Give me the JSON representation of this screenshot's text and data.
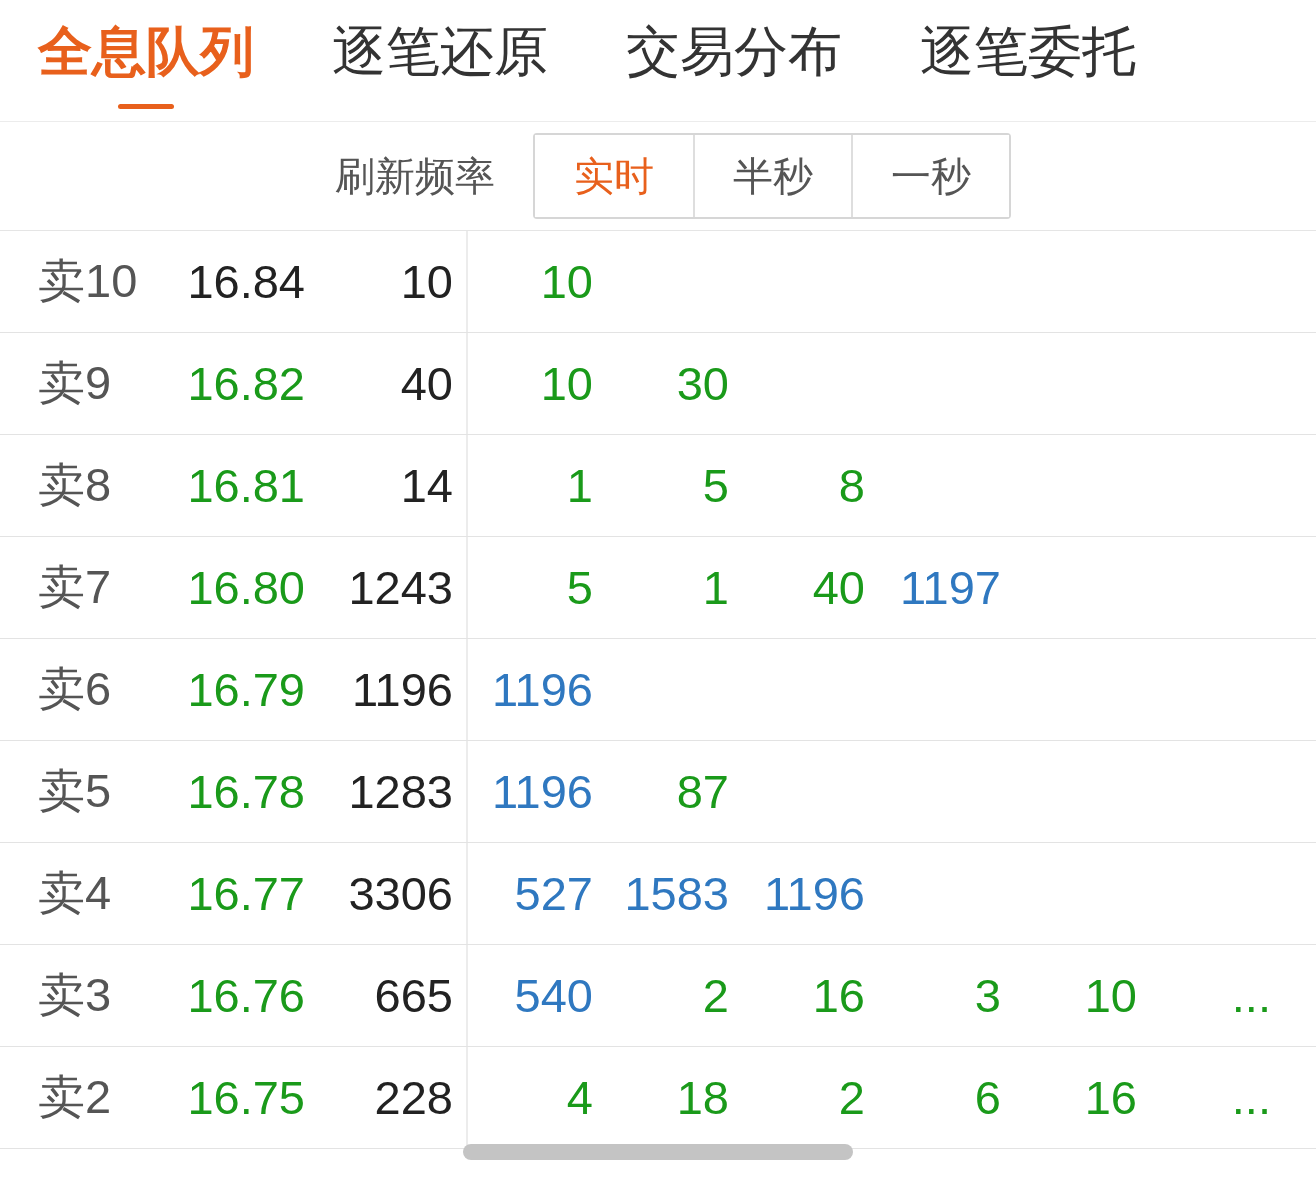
{
  "tabs": [
    {
      "label": "全息队列",
      "selected": true
    },
    {
      "label": "逐笔还原",
      "selected": false
    },
    {
      "label": "交易分布",
      "selected": false
    },
    {
      "label": "逐笔委托",
      "selected": false
    }
  ],
  "refresh": {
    "label": "刷新频率",
    "options": [
      {
        "label": "实时",
        "selected": true
      },
      {
        "label": "半秒",
        "selected": false
      },
      {
        "label": "一秒",
        "selected": false
      }
    ]
  },
  "rows": [
    {
      "label": "卖10",
      "price": {
        "text": "16.84",
        "color": "#222222"
      },
      "volume": "10",
      "queue": [
        {
          "text": "10",
          "color": "#1a9a1a"
        }
      ]
    },
    {
      "label": "卖9",
      "price": {
        "text": "16.82",
        "color": "#1a9a1a"
      },
      "volume": "40",
      "queue": [
        {
          "text": "10",
          "color": "#1a9a1a"
        },
        {
          "text": "30",
          "color": "#1a9a1a"
        }
      ]
    },
    {
      "label": "卖8",
      "price": {
        "text": "16.81",
        "color": "#1a9a1a"
      },
      "volume": "14",
      "queue": [
        {
          "text": "1",
          "color": "#1a9a1a"
        },
        {
          "text": "5",
          "color": "#1a9a1a"
        },
        {
          "text": "8",
          "color": "#1a9a1a"
        }
      ]
    },
    {
      "label": "卖7",
      "price": {
        "text": "16.80",
        "color": "#1a9a1a"
      },
      "volume": "1243",
      "queue": [
        {
          "text": "5",
          "color": "#1a9a1a"
        },
        {
          "text": "1",
          "color": "#1a9a1a"
        },
        {
          "text": "40",
          "color": "#1a9a1a"
        },
        {
          "text": "1197",
          "color": "#2f78c0"
        }
      ]
    },
    {
      "label": "卖6",
      "price": {
        "text": "16.79",
        "color": "#1a9a1a"
      },
      "volume": "1196",
      "queue": [
        {
          "text": "1196",
          "color": "#2f78c0"
        }
      ]
    },
    {
      "label": "卖5",
      "price": {
        "text": "16.78",
        "color": "#1a9a1a"
      },
      "volume": "1283",
      "queue": [
        {
          "text": "1196",
          "color": "#2f78c0"
        },
        {
          "text": "87",
          "color": "#1a9a1a"
        }
      ]
    },
    {
      "label": "卖4",
      "price": {
        "text": "16.77",
        "color": "#1a9a1a"
      },
      "volume": "3306",
      "queue": [
        {
          "text": "527",
          "color": "#2f78c0"
        },
        {
          "text": "1583",
          "color": "#2f78c0"
        },
        {
          "text": "1196",
          "color": "#2f78c0"
        }
      ]
    },
    {
      "label": "卖3",
      "price": {
        "text": "16.76",
        "color": "#1a9a1a"
      },
      "volume": "665",
      "queue": [
        {
          "text": "540",
          "color": "#2f78c0"
        },
        {
          "text": "2",
          "color": "#1a9a1a"
        },
        {
          "text": "16",
          "color": "#1a9a1a"
        },
        {
          "text": "3",
          "color": "#1a9a1a"
        },
        {
          "text": "10",
          "color": "#1a9a1a"
        }
      ],
      "more": "..."
    },
    {
      "label": "卖2",
      "price": {
        "text": "16.75",
        "color": "#1a9a1a"
      },
      "volume": "228",
      "queue": [
        {
          "text": "4",
          "color": "#1a9a1a"
        },
        {
          "text": "18",
          "color": "#1a9a1a"
        },
        {
          "text": "2",
          "color": "#1a9a1a"
        },
        {
          "text": "6",
          "color": "#1a9a1a"
        },
        {
          "text": "16",
          "color": "#1a9a1a"
        }
      ],
      "more": "..."
    }
  ]
}
